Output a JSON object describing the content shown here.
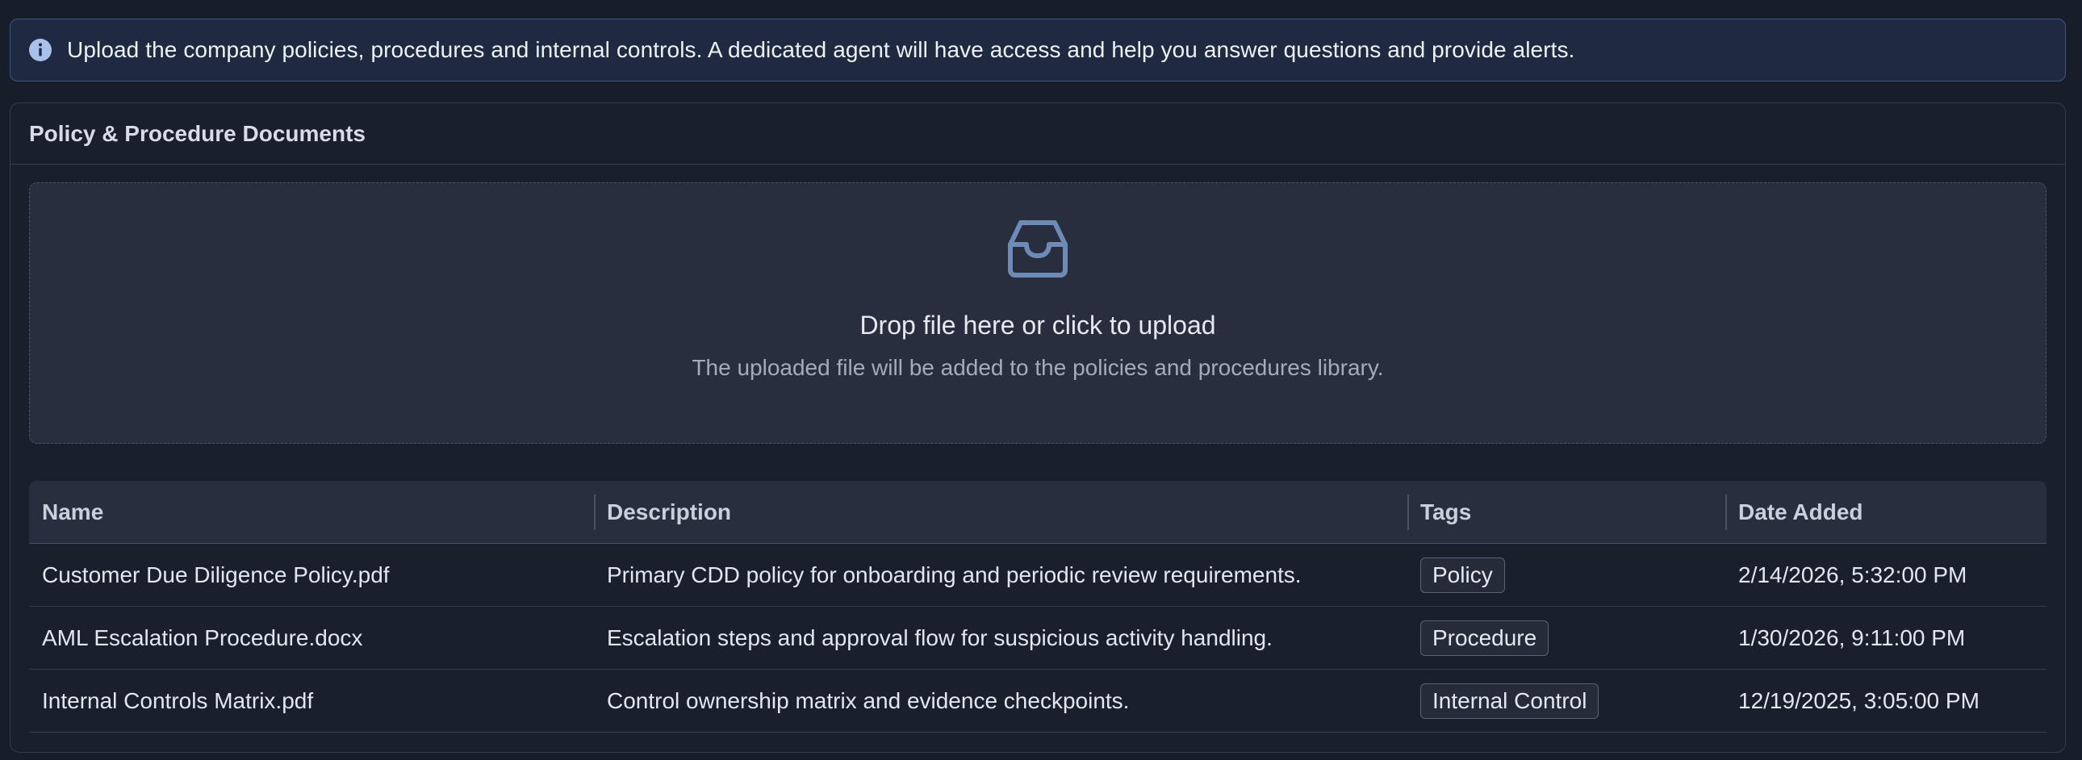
{
  "alert": {
    "icon": "info-icon",
    "text": "Upload the company policies, procedures and internal controls. A dedicated agent will have access and help you answer questions and provide alerts."
  },
  "card": {
    "title": "Policy & Procedure Documents"
  },
  "dropzone": {
    "icon": "inbox-icon",
    "title": "Drop file here or click to upload",
    "hint": "The uploaded file will be added to the policies and procedures library."
  },
  "table": {
    "headers": {
      "name": "Name",
      "description": "Description",
      "tags": "Tags",
      "date_added": "Date Added"
    },
    "rows": [
      {
        "name": "Customer Due Diligence Policy.pdf",
        "description": "Primary CDD policy for onboarding and periodic review requirements.",
        "tag": "Policy",
        "date_added": "2/14/2026, 5:32:00 PM"
      },
      {
        "name": "AML Escalation Procedure.docx",
        "description": "Escalation steps and approval flow for suspicious activity handling.",
        "tag": "Procedure",
        "date_added": "1/30/2026, 9:11:00 PM"
      },
      {
        "name": "Internal Controls Matrix.pdf",
        "description": "Control ownership matrix and evidence checkpoints.",
        "tag": "Internal Control",
        "date_added": "12/19/2025, 3:05:00 PM"
      }
    ]
  },
  "colors": {
    "background": "#181d2a",
    "alert_bg": "#1f2a40",
    "alert_border": "#3d5580",
    "accent_icon": "#6e8bb8",
    "dropzone_bg": "#282e3d"
  }
}
